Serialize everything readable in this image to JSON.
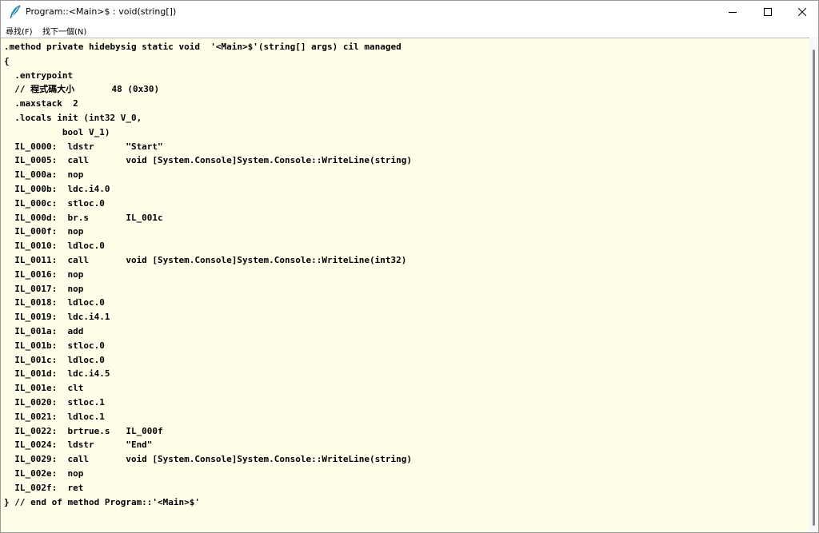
{
  "window": {
    "title": "Program::<Main>$ : void(string[])"
  },
  "menu": {
    "find": "尋找(F)",
    "find_next": "找下一個(N)"
  },
  "code_lines": [
    ".method private hidebysig static void  '<Main>$'(string[] args) cil managed",
    "{",
    "  .entrypoint",
    "  // 程式碼大小       48 (0x30)",
    "  .maxstack  2",
    "  .locals init (int32 V_0,",
    "           bool V_1)",
    "  IL_0000:  ldstr      \"Start\"",
    "  IL_0005:  call       void [System.Console]System.Console::WriteLine(string)",
    "  IL_000a:  nop",
    "  IL_000b:  ldc.i4.0",
    "  IL_000c:  stloc.0",
    "  IL_000d:  br.s       IL_001c",
    "  IL_000f:  nop",
    "  IL_0010:  ldloc.0",
    "  IL_0011:  call       void [System.Console]System.Console::WriteLine(int32)",
    "  IL_0016:  nop",
    "  IL_0017:  nop",
    "  IL_0018:  ldloc.0",
    "  IL_0019:  ldc.i4.1",
    "  IL_001a:  add",
    "  IL_001b:  stloc.0",
    "  IL_001c:  ldloc.0",
    "  IL_001d:  ldc.i4.5",
    "  IL_001e:  clt",
    "  IL_0020:  stloc.1",
    "  IL_0021:  ldloc.1",
    "  IL_0022:  brtrue.s   IL_000f",
    "  IL_0024:  ldstr      \"End\"",
    "  IL_0029:  call       void [System.Console]System.Console::WriteLine(string)",
    "  IL_002e:  nop",
    "  IL_002f:  ret",
    "} // end of method Program::'<Main>$'"
  ],
  "icons": {
    "app": "feather-quill-icon",
    "minimize": "minimize-icon",
    "maximize": "maximize-icon",
    "close": "close-icon"
  },
  "colors": {
    "content_background": "#fffee8",
    "icon_accent": "#1aa3d6"
  }
}
